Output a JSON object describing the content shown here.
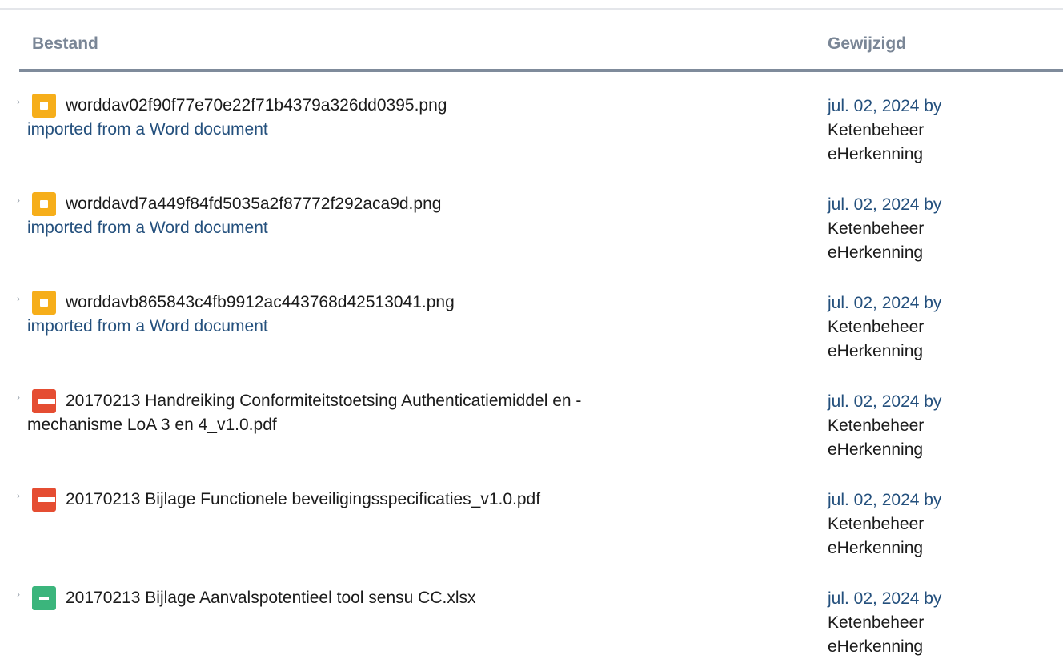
{
  "table": {
    "headers": {
      "file": "Bestand",
      "modified": "Gewijzigd"
    },
    "rows": [
      {
        "icon": "image-file-icon",
        "name": "worddav02f90f77e70e22f71b4379a326dd0395.png",
        "comment": "imported from a Word document",
        "date": "jul. 02, 2024 by",
        "user_line1": "Ketenbeheer",
        "user_line2": "eHerkenning"
      },
      {
        "icon": "image-file-icon",
        "name": "worddavd7a449f84fd5035a2f87772f292aca9d.png",
        "comment": "imported from a Word document",
        "date": "jul. 02, 2024 by",
        "user_line1": "Ketenbeheer",
        "user_line2": "eHerkenning"
      },
      {
        "icon": "image-file-icon",
        "name": "worddavb865843c4fb9912ac443768d42513041.png",
        "comment": "imported from a Word document",
        "date": "jul. 02, 2024 by",
        "user_line1": "Ketenbeheer",
        "user_line2": "eHerkenning"
      },
      {
        "icon": "pdf-file-icon",
        "name_line1": "20170213 Handreiking Conformiteitstoetsing Authenticatiemiddel en -",
        "name_line2": "mechanisme LoA 3 en 4_v1.0.pdf",
        "date": "jul. 02, 2024 by",
        "user_line1": "Ketenbeheer",
        "user_line2": "eHerkenning"
      },
      {
        "icon": "pdf-file-icon",
        "name": "20170213 Bijlage Functionele beveiligingsspecificaties_v1.0.pdf",
        "date": "jul. 02, 2024 by",
        "user_line1": "Ketenbeheer",
        "user_line2": "eHerkenning"
      },
      {
        "icon": "spreadsheet-file-icon",
        "name": "20170213 Bijlage Aanvalspotentieel tool sensu CC.xlsx",
        "date": "jul. 02, 2024 by",
        "user_line1": "Ketenbeheer",
        "user_line2": "eHerkenning"
      }
    ],
    "expander_glyph": "›",
    "colors": {
      "image_icon": "#f6ae1a",
      "pdf_icon": "#e54d32",
      "xlsx_icon": "#3bb57c",
      "link": "#24507d",
      "header_text": "#7a8696"
    }
  }
}
